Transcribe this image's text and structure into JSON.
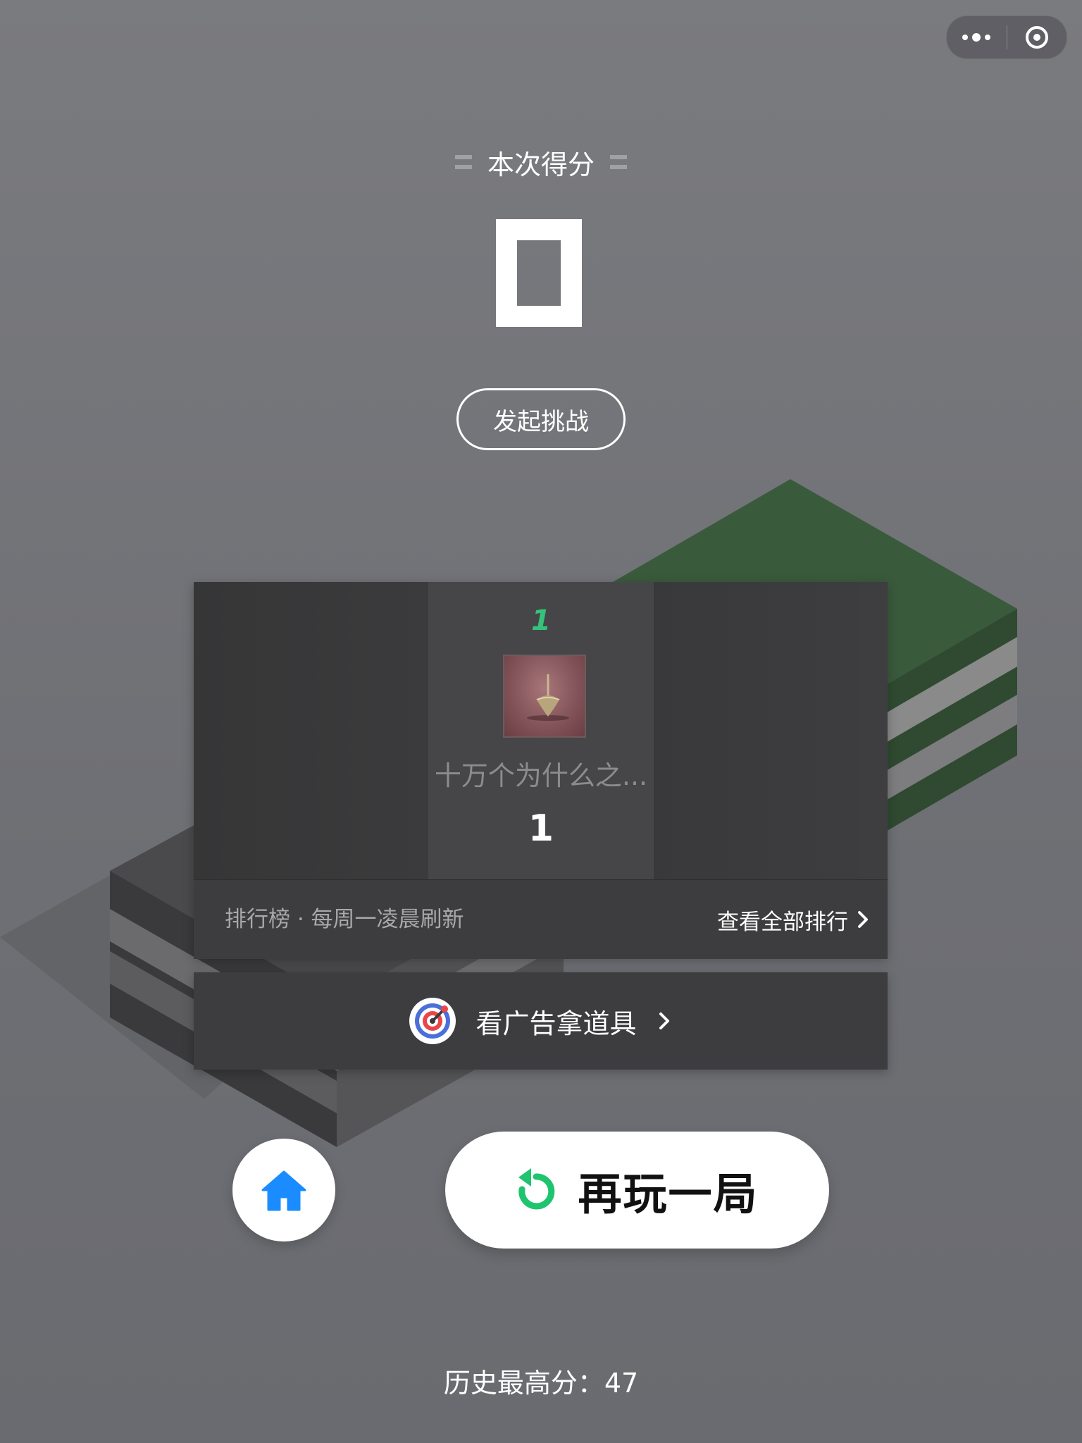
{
  "capsule": {
    "more_icon": "more-dots-icon",
    "close_icon": "target-close-icon"
  },
  "result": {
    "title": "本次得分",
    "score": "0",
    "challenge_label": "发起挑战"
  },
  "leaderboard": {
    "entries": [
      {
        "rank": "1",
        "name": "十万个为什么之...",
        "score": "1"
      }
    ],
    "footer_note": "排行榜 · 每周一凌晨刷新",
    "view_all_label": "查看全部排行"
  },
  "ad": {
    "label": "看广告拿道具",
    "icon": "ad-target-icon"
  },
  "actions": {
    "home_icon": "home-icon",
    "replay_label": "再玩一局",
    "replay_icon": "replay-icon"
  },
  "history": {
    "label": "历史最高分：",
    "value": "47"
  },
  "colors": {
    "accent_green": "#35c27a",
    "home_blue": "#1a8cff",
    "block_green": "#3a5a3c"
  }
}
